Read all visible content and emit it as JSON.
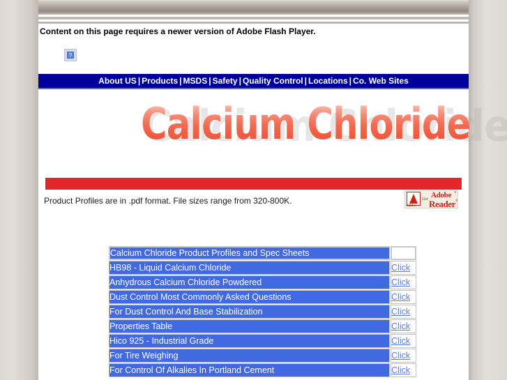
{
  "page": {
    "title": "Calcium Chloride",
    "logo_text": "Calcium Chloride"
  },
  "flash_notice": {
    "message": "Content on this page requires a newer version of Adobe Flash Player.",
    "placeholder_icon": "broken-plugin-icon",
    "placeholder_glyph": "?"
  },
  "nav": {
    "separator": "|",
    "items": [
      {
        "label": "About US"
      },
      {
        "label": "Products"
      },
      {
        "label": "MSDS"
      },
      {
        "label": "Safety"
      },
      {
        "label": "Quality Control"
      },
      {
        "label": "Locations"
      },
      {
        "label": "Co. Web Sites"
      }
    ]
  },
  "pdf_note": {
    "text": "Product Profiles are in .pdf format. File sizes range from 320-800K.",
    "badge": {
      "name": "adobe-reader-badge",
      "a_label": "Adobe",
      "get_label": "Get",
      "adobe_label": "Adobe",
      "reader_label": "Reader",
      "tm": "®"
    }
  },
  "product_table": {
    "click_label": "Click",
    "rows": [
      {
        "label": "Calcium Chloride Product Profiles and Spec Sheets",
        "click": false,
        "header": true
      },
      {
        "label": "HB98 - Liquid Calcium Chloride",
        "click": true
      },
      {
        "label": "Anhydrous Calcium Chloride Powdered",
        "click": true
      },
      {
        "label": "Dust Control Most Commonly Asked Questions",
        "click": true
      },
      {
        "label": "For Dust Control And Base Stabilization",
        "click": true
      },
      {
        "label": "Properties Table",
        "click": true
      },
      {
        "label": "Hico 925 - Industrial Grade",
        "click": true
      },
      {
        "label": "For Tire Weighing",
        "click": true
      },
      {
        "label": "For Control Of Alkalies In Portland Cement",
        "click": true
      }
    ]
  },
  "colors": {
    "nav_blue": "#000099",
    "table_blue": "#4169e1",
    "red_bar": "#e4252c",
    "logo_red": "#ee4b2e",
    "page_bg": "#dedad5"
  }
}
